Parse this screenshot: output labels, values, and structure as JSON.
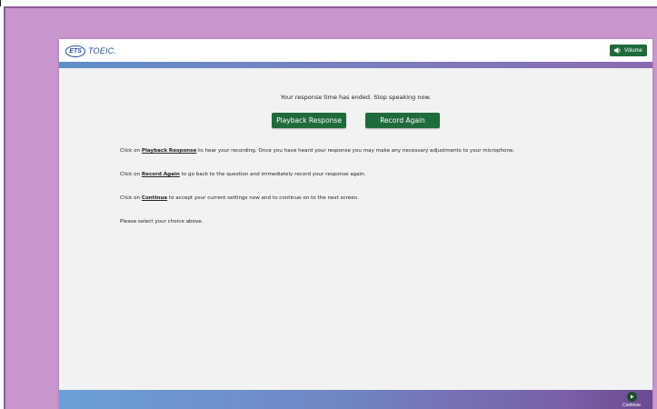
{
  "header": {
    "logo_badge": "ETS",
    "logo_text": "TOEIC.",
    "volume_label": "Volume"
  },
  "main": {
    "status_message": "Your response time has ended. Stop speaking now.",
    "playback_button": "Playback Response",
    "record_button": "Record Again",
    "instructions": [
      {
        "prefix": "Click on ",
        "link": "Playback Response",
        "suffix": " to hear your recording. Once you have heard your response you may make any necessary adjustments to your microphone."
      },
      {
        "prefix": "Click on ",
        "link": "Record Again",
        "suffix": " to go back to the question and immediately record your response again."
      },
      {
        "prefix": "Click on ",
        "link": "Continue",
        "suffix": " to accept your current settings now and to continue on to the next screen."
      }
    ],
    "select_prompt": "Please select your choice above."
  },
  "footer": {
    "continue_label": "Continue"
  },
  "colors": {
    "frame": "#c896cd",
    "button_green": "#1f6b3b",
    "logo_blue": "#1f4e9a"
  },
  "icons": [
    "speaker-icon",
    "continue-arrow-icon"
  ]
}
